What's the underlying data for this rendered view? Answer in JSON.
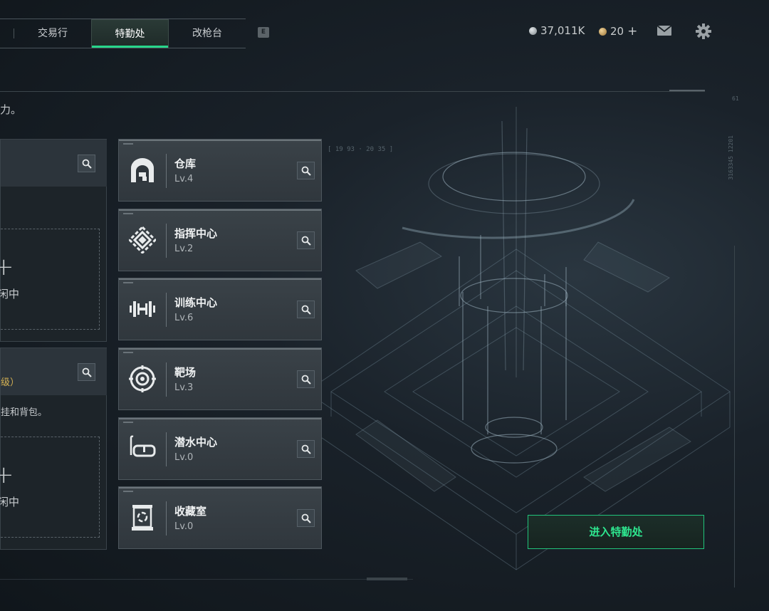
{
  "tabs": [
    {
      "label": "交易行",
      "active": false
    },
    {
      "label": "特勤处",
      "active": true
    },
    {
      "label": "改枪台",
      "active": false
    }
  ],
  "tab_hotkey": "E",
  "currency": {
    "primary": "37,011K",
    "secondary": "20",
    "add_symbol": "+",
    "primary_color": "#9aa3a8",
    "secondary_color": "#c9a45a"
  },
  "intro_text": "力。",
  "panels": [
    {
      "badge": "",
      "subtitle": "",
      "slot_plus": "+",
      "slot_label": "闲中"
    },
    {
      "badge": "级）",
      "subtitle": "挂和背包。",
      "slot_plus": "+",
      "slot_label": "闲中"
    }
  ],
  "facilities": [
    {
      "name": "仓库",
      "level": "Lv.4",
      "icon": "vault-door-icon"
    },
    {
      "name": "指挥中心",
      "level": "Lv.2",
      "icon": "command-center-icon"
    },
    {
      "name": "训练中心",
      "level": "Lv.6",
      "icon": "dumbbell-icon"
    },
    {
      "name": "靶场",
      "level": "Lv.3",
      "icon": "target-icon"
    },
    {
      "name": "潜水中心",
      "level": "Lv.0",
      "icon": "diving-mask-icon"
    },
    {
      "name": "收藏室",
      "level": "Lv.0",
      "icon": "display-case-icon"
    }
  ],
  "enter_button": "进入特勤处",
  "accent_color": "#27d68a",
  "hud": {
    "time_range": "[ 19 93 · 20 35 ]",
    "coords": "3163345 12201",
    "marker": "61"
  }
}
